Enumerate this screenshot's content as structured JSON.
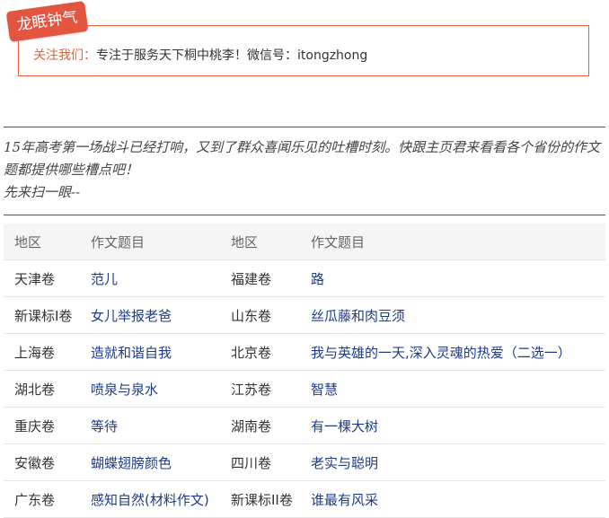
{
  "header": {
    "brand_tag": "龙眠钟气",
    "follow_label": "关注我们：",
    "follow_text": "专注于服务天下桐中桃李！微信号：itongzhong"
  },
  "intro": {
    "lines": [
      "15年高考第一场战斗已经打响，又到了群众喜闻乐见的吐槽时刻。快跟主页君来看看各个省份的作文题都提供哪些槽点吧！",
      "先来扫一眼--"
    ]
  },
  "table": {
    "headers": [
      "地区",
      "作文题目",
      "地区",
      "作文题目"
    ],
    "rows": [
      [
        "天津卷",
        "范儿",
        "福建卷",
        "路"
      ],
      [
        "新课标I卷",
        "女儿举报老爸",
        "山东卷",
        "丝瓜藤和肉豆须"
      ],
      [
        "上海卷",
        "造就和谐自我",
        "北京卷",
        "我与英雄的一天,深入灵魂的热爱（二选一）"
      ],
      [
        "湖北卷",
        "喷泉与泉水",
        "江苏卷",
        "智慧"
      ],
      [
        "重庆卷",
        "等待",
        "湖南卷",
        "有一棵大树"
      ],
      [
        "安徽卷",
        "蝴蝶翅膀颜色",
        "四川卷",
        "老实与聪明"
      ],
      [
        "广东卷",
        "感知自然(材料作文)",
        "新课标II卷",
        "谁最有风采"
      ]
    ]
  },
  "colors": {
    "accent": "#e8603c",
    "topic_text": "#1f3a8a"
  }
}
